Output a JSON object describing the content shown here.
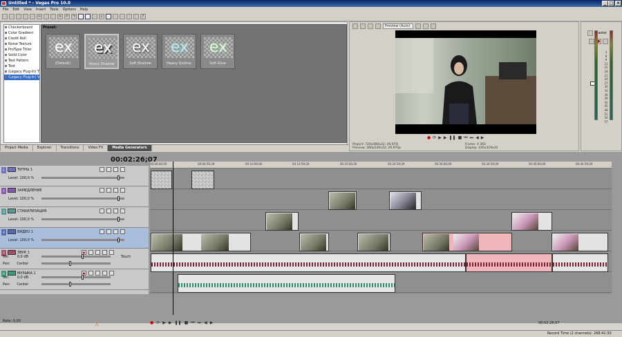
{
  "window": {
    "title": "Untitled * - Vegas Pro 10.0"
  },
  "menu": [
    "File",
    "Edit",
    "View",
    "Insert",
    "Tools",
    "Options",
    "Help"
  ],
  "explorer": {
    "tree_items": [
      "Checkerboard",
      "Color Gradient",
      "Credit Roll",
      "Noise Texture",
      "ProType Titler",
      "Solid Color",
      "Test Pattern",
      "Text",
      "(Legacy Plug-In) T",
      "(Legacy Plug-In) V"
    ],
    "preset_label": "Preset:",
    "thumb_text": "ex",
    "presets": [
      "(Default)",
      "Heavy Shadow",
      "Soft Shadow",
      "Heavy Outline",
      "Soft Glow"
    ],
    "tabs": [
      "Project Media",
      "Explorer",
      "Transitions",
      "Video FX",
      "Media Generators"
    ]
  },
  "preview": {
    "mode": "Preview (Auto)",
    "project_label": "Project:",
    "project_value": "720x480x32; 29,970i",
    "preview_label": "Preview:",
    "preview_value": "360x240x32; 29,970p",
    "frame_label": "Frame:",
    "frame_value": "4 393",
    "display_label": "Display:",
    "display_value": "435x319x32"
  },
  "master": {
    "title": "Master",
    "scale": [
      "3",
      "6",
      "9",
      "12",
      "15",
      "18",
      "21",
      "24",
      "27",
      "30",
      "33",
      "36",
      "39",
      "42",
      "45",
      "48",
      "51",
      "54",
      "57"
    ]
  },
  "timeline": {
    "timecode": "00:02:26;07",
    "ruler": [
      "00:00:00;00",
      "00:04:59;29",
      "00:10:00;00",
      "00:14:59;29",
      "00:20:00;00",
      "00:24:59;29",
      "00:30:00;00",
      "00:34:59;29",
      "00:40:00;00",
      "00:44:59;29"
    ],
    "tracks": [
      {
        "num": "1",
        "name": "ТИТРЫ 1",
        "level_label": "Level:",
        "level": "100,0 %",
        "color": "#7070c0"
      },
      {
        "num": "2",
        "name": "ЗАМЕДЛЕНИЕ",
        "level_label": "Level:",
        "level": "100,0 %",
        "color": "#8a5ab0"
      },
      {
        "num": "3",
        "name": "СТАБИЛИЗАЦИЯ",
        "level_label": "Level:",
        "level": "100,0 %",
        "color": "#5a9a9a"
      },
      {
        "num": "4",
        "name": "ВИДЕО 1",
        "level_label": "Level:",
        "level": "100,0 %",
        "color": "#5a6ab0"
      },
      {
        "num": "5",
        "name": "ЗВУК 1",
        "vol_label": "Vol:",
        "vol": "0,0 dB",
        "pan_label": "Pan:",
        "pan": "Center",
        "mode": "Touch",
        "color": "#a0506a"
      },
      {
        "num": "6",
        "name": "МУЗЫКА 1",
        "vol_label": "Vol:",
        "vol": "0,0 dB",
        "pan_label": "Pan:",
        "pan": "Center",
        "color": "#3a9a7a"
      }
    ],
    "rate": "Rate: 0,00",
    "position": "00:02:26;07"
  },
  "status": {
    "record": "Record Time (2 channels): 268:41:30"
  }
}
